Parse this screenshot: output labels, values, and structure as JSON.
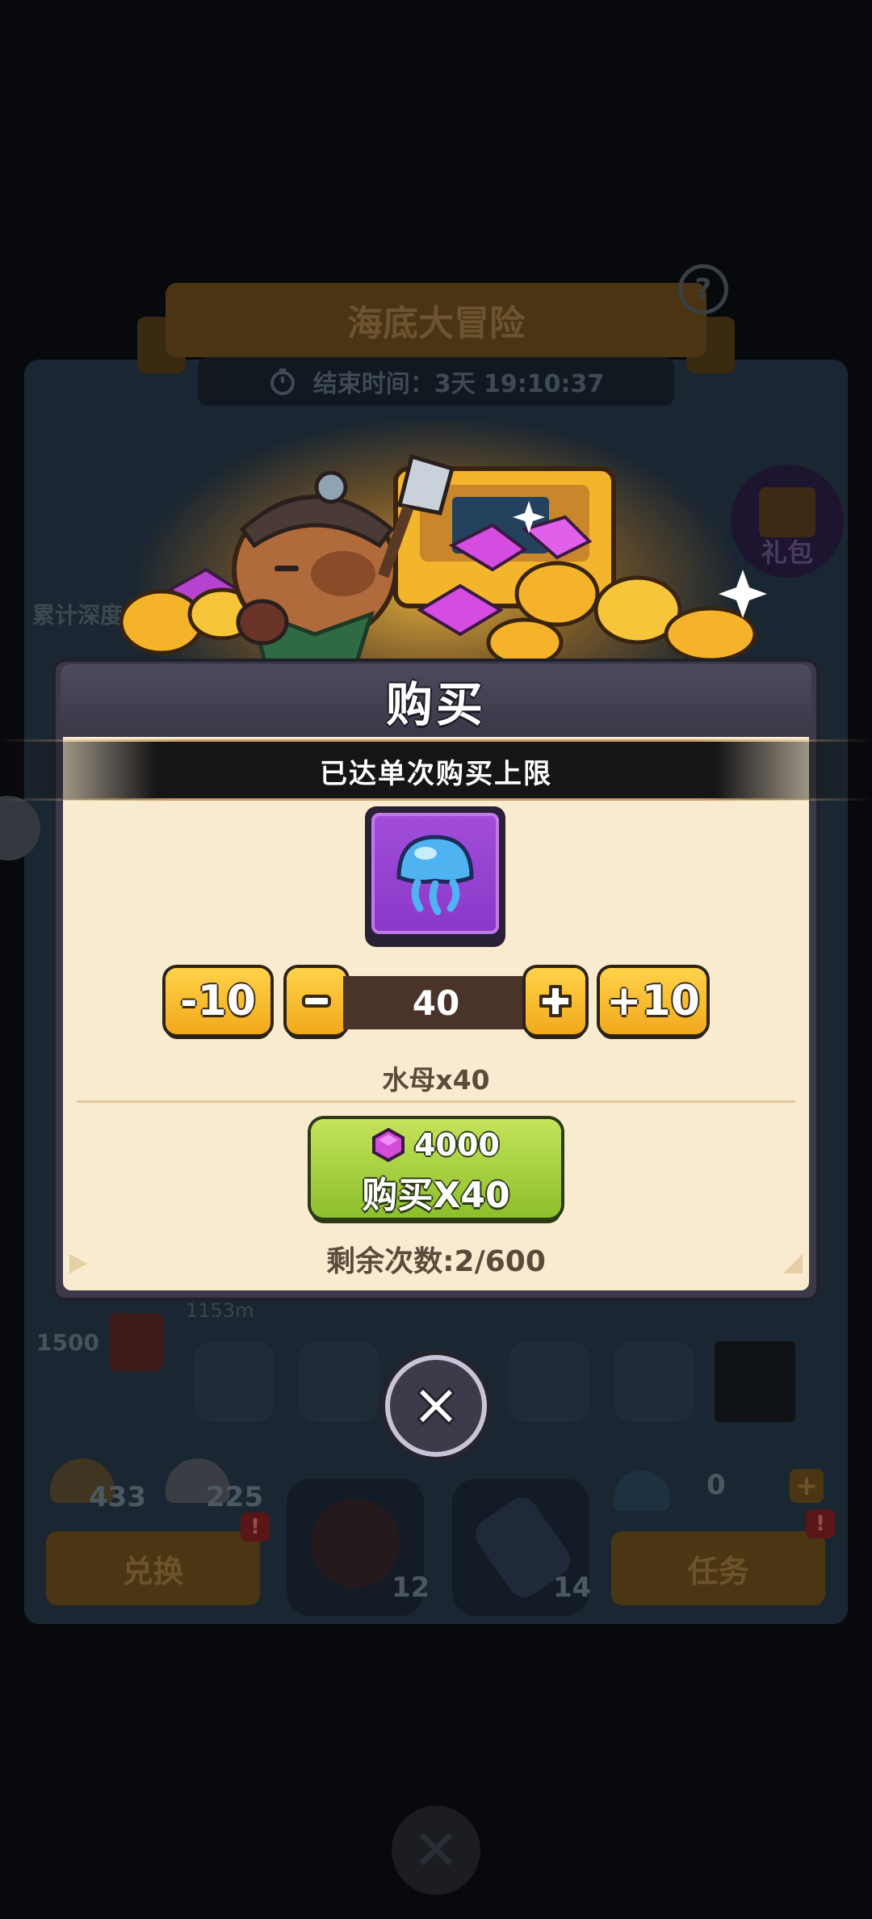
{
  "background": {
    "event_title": "海底大冒险",
    "end_time_label": "结束时间：3天 19:10:37",
    "help_glyph": "?",
    "gift_label": "礼包",
    "depth_label": "累计深度",
    "depth_left_number": "1500",
    "depth_meter_text": "1153m",
    "shell_counts": [
      "433",
      "225"
    ],
    "tool_counts": [
      "12",
      "14"
    ],
    "resource_count": "0",
    "exchange_label": "兑换",
    "task_label": "任务",
    "badge_glyph": "!",
    "plus_glyph": "+",
    "close_glyph": "✕"
  },
  "modal": {
    "title": "购买",
    "limit_notice": "已达单次购买上限",
    "item_icon": "jellyfish-icon",
    "buttons": {
      "minus_ten": "-10",
      "minus_one_icon": "minus-icon",
      "plus_one_icon": "plus-icon",
      "plus_ten": "+10"
    },
    "quantity": "40",
    "item_name": "水母x40",
    "price": "4000",
    "price_icon": "gem-icon",
    "buy_label": "购买X40",
    "remaining": "剩余次数:2/600",
    "close_icon": "close-icon"
  },
  "colors": {
    "modal_body": "#f8ebcf",
    "item_bg": "#9b45d4",
    "buy_green": "#a8d140",
    "qty_orange": "#f7b82a"
  }
}
